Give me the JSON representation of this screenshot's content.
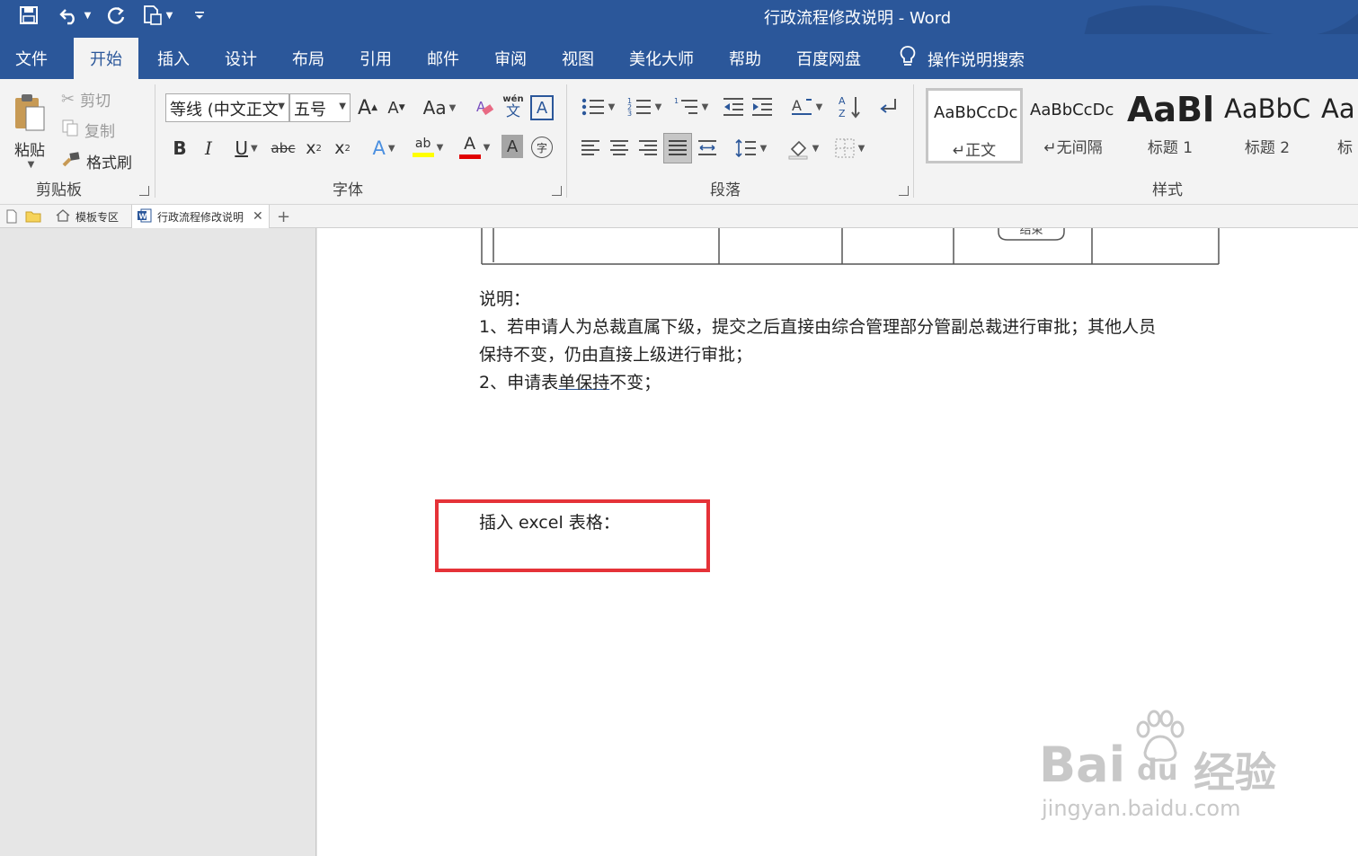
{
  "titlebar": {
    "title": "行政流程修改说明  -  Word",
    "quick_access": [
      "save-icon",
      "undo-icon",
      "redo-icon",
      "new-document-icon",
      "customize-icon"
    ]
  },
  "ribbon_tabs": [
    "文件",
    "开始",
    "插入",
    "设计",
    "布局",
    "引用",
    "邮件",
    "审阅",
    "视图",
    "美化大师",
    "帮助",
    "百度网盘"
  ],
  "active_tab": "开始",
  "tell_me": "操作说明搜索",
  "clipboard": {
    "paste": "粘贴",
    "cut": "剪切",
    "copy": "复制",
    "format_painter": "格式刷",
    "group_label": "剪贴板"
  },
  "font": {
    "font_name": "等线 (中文正文",
    "font_size": "五号",
    "grow": "A",
    "shrink": "A",
    "change_case": "Aa",
    "phonetic_top": "wén",
    "phonetic_bottom": "文",
    "char_border": "A",
    "bold": "B",
    "italic": "I",
    "underline": "U",
    "strike": "abc",
    "subscript": "x",
    "superscript": "x",
    "text_effects": "A",
    "highlight": "ab",
    "font_color": "A",
    "char_shading": "A",
    "enclose": "字",
    "group_label": "字体"
  },
  "paragraph": {
    "group_label": "段落"
  },
  "styles": {
    "items": [
      {
        "sample": "AaBbCcDc",
        "name": "正文"
      },
      {
        "sample": "AaBbCcDc",
        "name": "无间隔"
      },
      {
        "sample": "AaBl",
        "name": "标题 1"
      },
      {
        "sample": "AaBbC",
        "name": "标题 2"
      },
      {
        "sample": "Aa",
        "name": "标"
      }
    ],
    "group_label": "样式"
  },
  "doc_tabs": {
    "template": "模板专区",
    "current": "行政流程修改说明",
    "add": "+"
  },
  "document": {
    "flow_end": "结束",
    "lines": [
      "说明：",
      "1、若申请人为总裁直属下级，提交之后直接由综合管理部分管副总裁进行审批；其他人员",
      "保持不变，仍由直接上级进行审批；"
    ],
    "line4_a": "2、申请表",
    "line4_b": "单保持",
    "line4_c": "不变；",
    "insert_label": "插入 excel 表格："
  },
  "watermark": {
    "brand_a": "Bai",
    "brand_b": "du",
    "brand_cn": "经验",
    "url": "jingyan.baidu.com"
  },
  "colors": {
    "word_blue": "#2b579a",
    "highlight_box": "#e53238"
  }
}
